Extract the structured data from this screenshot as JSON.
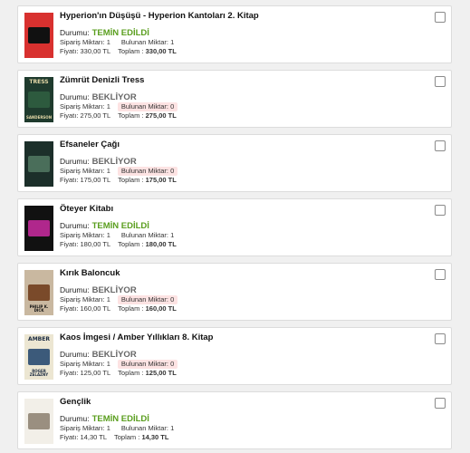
{
  "labels": {
    "status": "Durumu:",
    "ordered": "Sipariş Miktarı:",
    "found": "Bulunan Miktar:",
    "price": "Fiyatı:",
    "total": "Toplam :"
  },
  "colors": {
    "available": "#5a9e1e",
    "pending": "#666666",
    "missing_bg": "#fde3e3",
    "checkbox_border": "#8a8a8a"
  },
  "items": [
    {
      "title": "Hyperion'ın Düşüşü - Hyperion Kantoları 2. Kitap",
      "status": "TEMİN EDİLDİ",
      "status_kind": "available",
      "ordered": "1",
      "found": "1",
      "found_missing": false,
      "price": "330,00 TL",
      "total": "330,00 TL",
      "cover": {
        "bg": "#d8312f",
        "accent": "#111111",
        "text_color": "#ffffff",
        "t1": "",
        "t2": ""
      }
    },
    {
      "title": "Zümrüt Denizli Tress",
      "status": "BEKLİYOR",
      "status_kind": "pending",
      "ordered": "1",
      "found": "0",
      "found_missing": true,
      "price": "275,00 TL",
      "total": "275,00 TL",
      "cover": {
        "bg": "#1f3b2e",
        "accent": "#2d5a3e",
        "text_color": "#e6d9a8",
        "t1": "TRESS",
        "t2": "SANDERSON"
      }
    },
    {
      "title": "Efsaneler Çağı",
      "status": "BEKLİYOR",
      "status_kind": "pending",
      "ordered": "1",
      "found": "0",
      "found_missing": true,
      "price": "175,00 TL",
      "total": "175,00 TL",
      "cover": {
        "bg": "#1c2f2a",
        "accent": "#4a6e5a",
        "text_color": "#cfe0c8",
        "t1": "",
        "t2": ""
      }
    },
    {
      "title": "Öteyer Kitabı",
      "status": "TEMİN EDİLDİ",
      "status_kind": "available",
      "ordered": "1",
      "found": "1",
      "found_missing": false,
      "price": "180,00 TL",
      "total": "180,00 TL",
      "cover": {
        "bg": "#111111",
        "accent": "#b0278c",
        "text_color": "#e23aa8",
        "t1": "",
        "t2": ""
      }
    },
    {
      "title": "Kırık Baloncuk",
      "status": "BEKLİYOR",
      "status_kind": "pending",
      "ordered": "1",
      "found": "0",
      "found_missing": true,
      "price": "160,00 TL",
      "total": "160,00 TL",
      "cover": {
        "bg": "#c9b8a0",
        "accent": "#7a4a2a",
        "text_color": "#111111",
        "t1": "",
        "t2": "PHILIP K. DICK"
      }
    },
    {
      "title": "Kaos İmgesi / Amber Yıllıkları 8. Kitap",
      "status": "BEKLİYOR",
      "status_kind": "pending",
      "ordered": "1",
      "found": "0",
      "found_missing": true,
      "price": "125,00 TL",
      "total": "125,00 TL",
      "cover": {
        "bg": "#ece6d2",
        "accent": "#3c5a7a",
        "text_color": "#1a2a40",
        "t1": "AMBER",
        "t2": "ROGER ZELAZNY"
      }
    },
    {
      "title": "Gençlik",
      "status": "TEMİN EDİLDİ",
      "status_kind": "available",
      "ordered": "1",
      "found": "1",
      "found_missing": false,
      "price": "14,30 TL",
      "total": "14,30 TL",
      "cover": {
        "bg": "#f2efe8",
        "accent": "#9a8f80",
        "text_color": "#444444",
        "t1": "",
        "t2": ""
      }
    }
  ]
}
